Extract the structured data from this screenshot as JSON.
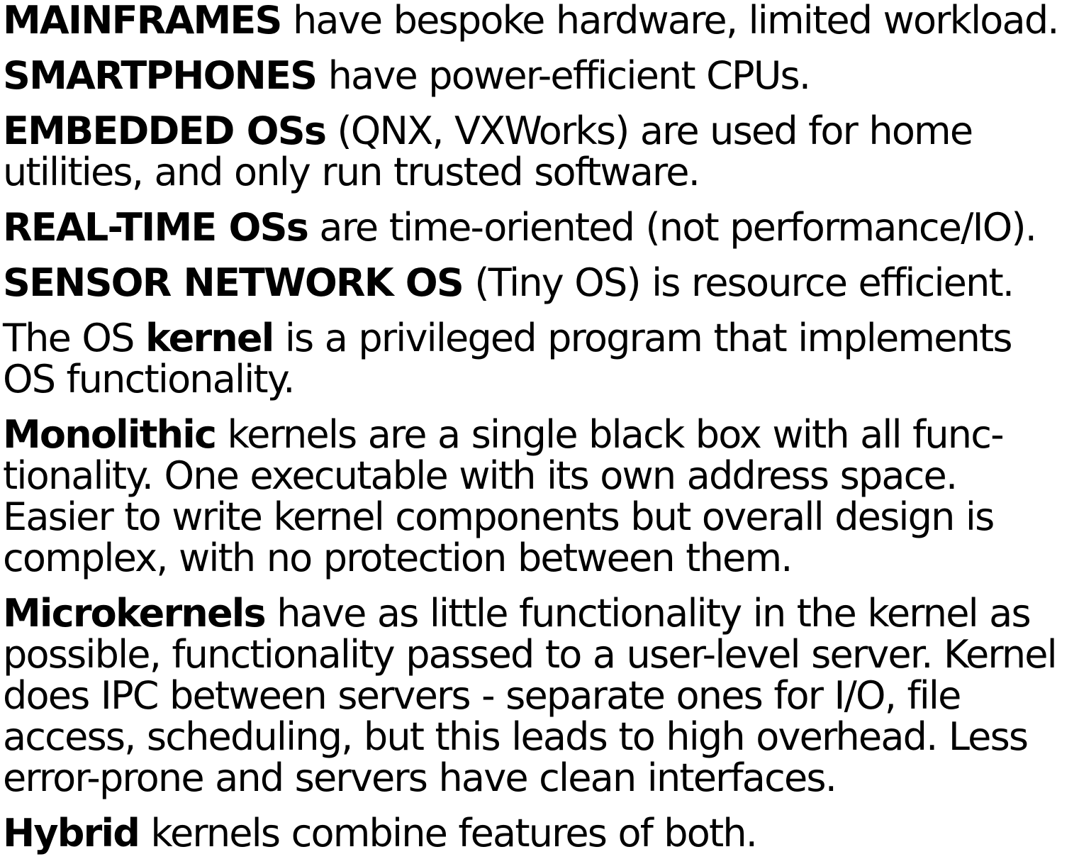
{
  "paragraphs": [
    {
      "id": "mainframes",
      "lines": [
        [
          {
            "b": "MAINFRAMES"
          },
          {
            "t": " have bespoke hardware, limited workload."
          }
        ]
      ]
    },
    {
      "id": "smartphones",
      "lines": [
        [
          {
            "b": "SMARTPHONES"
          },
          {
            "t": " have power-efficient CPUs."
          }
        ]
      ]
    },
    {
      "id": "embedded-os",
      "lines": [
        [
          {
            "b": "EMBEDDED OSs"
          },
          {
            "t": " (QNX, VXWorks) are used for home"
          }
        ],
        [
          {
            "t": "utilities, and only run trusted software."
          }
        ]
      ]
    },
    {
      "id": "real-time-os",
      "lines": [
        [
          {
            "b": "REAL-TIME OSs"
          },
          {
            "t": " are time-oriented (not performance/IO)."
          }
        ]
      ]
    },
    {
      "id": "sensor-network-os",
      "lines": [
        [
          {
            "b": "SENSOR NETWORK OS"
          },
          {
            "t": " (Tiny OS) is resource efficient."
          }
        ]
      ]
    },
    {
      "id": "kernel",
      "lines": [
        [
          {
            "t": "The OS "
          },
          {
            "b": "kernel"
          },
          {
            "t": " is a privileged program that implements"
          }
        ],
        [
          {
            "t": "OS functionality."
          }
        ]
      ]
    },
    {
      "id": "monolithic",
      "lines": [
        [
          {
            "b": "Monolithic"
          },
          {
            "t": " kernels are a single black box with all func-"
          }
        ],
        [
          {
            "t": "tionality. One executable with its own address space."
          }
        ],
        [
          {
            "t": "Easier to write kernel components but overall design is"
          }
        ],
        [
          {
            "t": "complex, with no protection between them."
          }
        ]
      ]
    },
    {
      "id": "microkernels",
      "lines": [
        [
          {
            "b": "Microkernels"
          },
          {
            "t": " have as little functionality in the kernel as"
          }
        ],
        [
          {
            "t": "possible, functionality passed to a user-level server. Kernel"
          }
        ],
        [
          {
            "t": "does IPC between servers - separate ones for I/O, file"
          }
        ],
        [
          {
            "t": "access, scheduling, but this leads to high overhead. Less"
          }
        ],
        [
          {
            "t": "error-prone and servers have clean interfaces."
          }
        ]
      ]
    },
    {
      "id": "hybrid",
      "lines": [
        [
          {
            "b": "Hybrid"
          },
          {
            "t": " kernels combine features of both."
          }
        ]
      ]
    }
  ]
}
